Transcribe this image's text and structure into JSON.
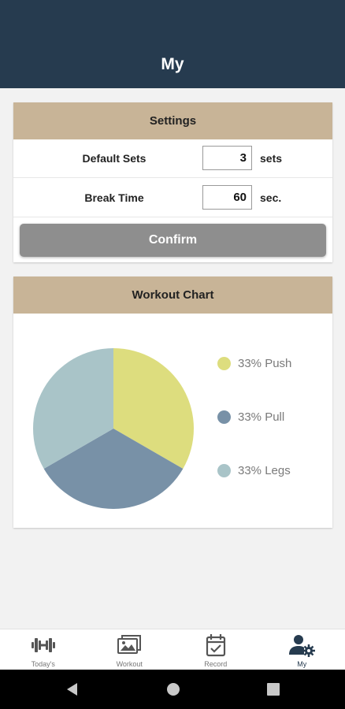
{
  "header": {
    "title": "My"
  },
  "settings": {
    "title": "Settings",
    "default_sets": {
      "label": "Default Sets",
      "value": "3",
      "unit": "sets"
    },
    "break_time": {
      "label": "Break Time",
      "value": "60",
      "unit": "sec."
    },
    "confirm_label": "Confirm"
  },
  "workout_chart": {
    "title": "Workout Chart",
    "legend": [
      {
        "label": "33% Push",
        "color": "#dddd7e"
      },
      {
        "label": "33% Pull",
        "color": "#7891a7"
      },
      {
        "label": "33% Legs",
        "color": "#a9c4c8"
      }
    ]
  },
  "chart_data": {
    "type": "pie",
    "categories": [
      "Push",
      "Pull",
      "Legs"
    ],
    "values": [
      33,
      33,
      33
    ],
    "colors": [
      "#dddd7e",
      "#7891a7",
      "#a9c4c8"
    ],
    "legend_labels": [
      "33% Push",
      "33% Pull",
      "33% Legs"
    ],
    "legend_placement": "right"
  },
  "bottom_nav": {
    "items": [
      {
        "label": "Today's",
        "icon": "dumbbell-icon"
      },
      {
        "label": "Workout",
        "icon": "gallery-icon"
      },
      {
        "label": "Record",
        "icon": "calendar-check-icon"
      },
      {
        "label": "My",
        "icon": "user-settings-icon"
      }
    ],
    "active_index": 3
  },
  "system_nav": {
    "icons": [
      "back-icon",
      "home-icon",
      "recents-icon"
    ]
  }
}
